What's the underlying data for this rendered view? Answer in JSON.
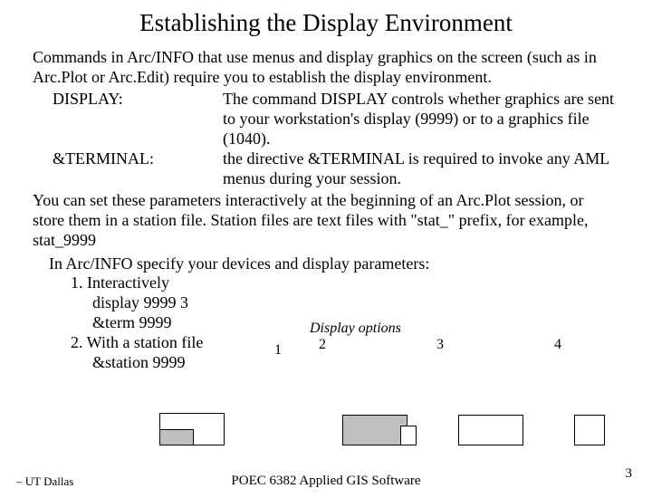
{
  "title": "Establishing the Display Environment",
  "intro": "Commands in Arc/INFO that use menus and display graphics on the screen (such as in Arc.Plot or Arc.Edit) require you to establish the display environment.",
  "cmds": [
    {
      "label": "DISPLAY:",
      "desc": "The command DISPLAY controls whether graphics are sent to your workstation's display (9999) or to a graphics file (1040)."
    },
    {
      "label": "&TERMINAL:",
      "desc": "the directive &TERMINAL is required to invoke any AML menus during your session."
    }
  ],
  "para2": "You can set these parameters interactively at the beginning of an Arc.Plot session, or store them in a station file.  Station files are text files with \"stat_\" prefix, for example, stat_9999",
  "specify": "In Arc/INFO specify your devices and display parameters:",
  "steps": {
    "s1": "1.  Interactively",
    "s1a": "display 9999  3",
    "s1b": "&term  9999",
    "s2": "2. With a station file",
    "s2a": "&station 9999"
  },
  "opts": {
    "header": "Display options",
    "n1": "1",
    "n2": "2",
    "n3": "3",
    "n4": "4"
  },
  "footer": {
    "left": "– UT Dallas",
    "center": "POEC 6382 Applied GIS Software",
    "page": "3"
  }
}
